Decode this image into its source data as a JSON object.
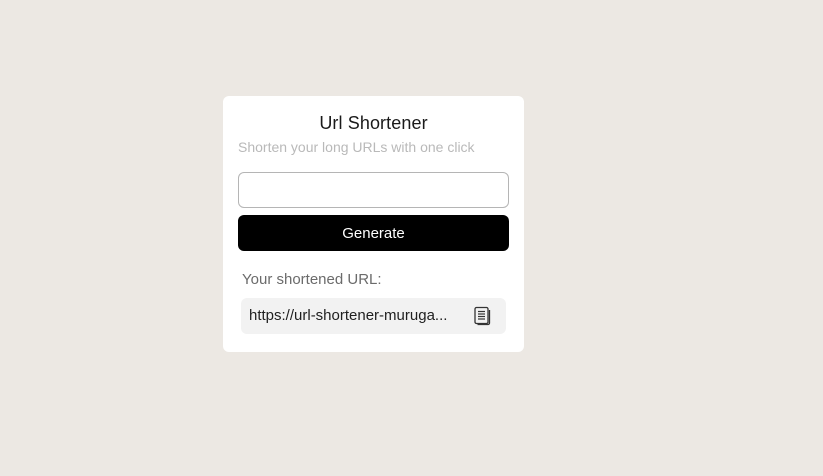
{
  "card": {
    "title": "Url Shortener",
    "subtitle": "Shorten your long URLs with one click"
  },
  "form": {
    "url_input_value": "",
    "url_input_placeholder": "",
    "generate_label": "Generate"
  },
  "result": {
    "label": "Your shortened URL:",
    "url": "https://url-shortener-muruga...",
    "copy_icon": "copy-icon"
  },
  "colors": {
    "background": "#ece8e3",
    "card": "#ffffff",
    "button": "#000000",
    "result_box": "#f2f2f2"
  }
}
